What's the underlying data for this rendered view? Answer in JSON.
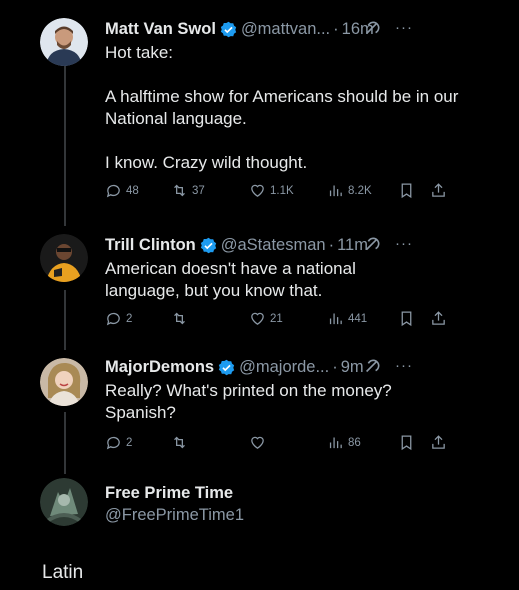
{
  "tweets": [
    {
      "name": "Matt Van Swol",
      "handle": "@mattvan...",
      "time": "16m",
      "text": "Hot take:\n\nA halftime show for Americans should be in our National language.\n\nI know. Crazy wild thought.",
      "replies": "48",
      "reposts": "37",
      "likes": "1.1K",
      "views": "8.2K"
    },
    {
      "name": "Trill Clinton",
      "handle": "@aStatesman",
      "time": "11m",
      "text": "American doesn't have a national language, but you know that.",
      "replies": "2",
      "reposts": "",
      "likes": "21",
      "views": "441"
    },
    {
      "name": "MajorDemons",
      "handle": "@majorde...",
      "time": "9m",
      "text": "Really? What's printed on the money? Spanish?",
      "replies": "2",
      "reposts": "",
      "likes": "",
      "views": "86"
    },
    {
      "name": "Free Prime Time",
      "handle": "@FreePrimeTime1"
    }
  ],
  "footer": {
    "label": "Latin"
  },
  "colors": {
    "verified": "#1d9bf0",
    "muted": "#8b98a5",
    "background": "#000000",
    "text": "#e7e9ea"
  },
  "icons": [
    "reply-icon",
    "repost-icon",
    "like-icon",
    "views-icon",
    "bookmark-icon",
    "share-icon",
    "grok-icon",
    "more-icon",
    "verified-icon"
  ],
  "separator": "·",
  "more_label": "···"
}
